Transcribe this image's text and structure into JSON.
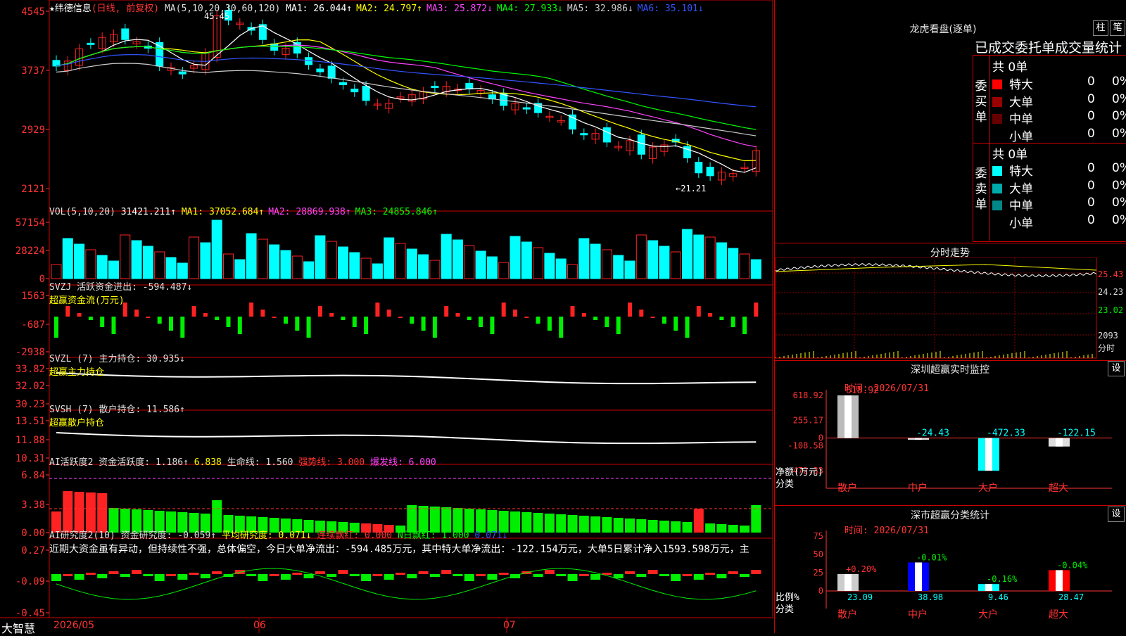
{
  "stock": {
    "name": "★纬德信息",
    "mode": "(日线, 前复权)",
    "ma_text": "MA(5,10,20,30,60,120)",
    "ma": [
      {
        "label": "MA1: 26.044↑",
        "color": "#ffffff"
      },
      {
        "label": "MA2: 24.797↑",
        "color": "#ffff00"
      },
      {
        "label": "MA3: 25.872↓",
        "color": "#ff44ff"
      },
      {
        "label": "MA4: 27.933↓",
        "color": "#00ff00"
      },
      {
        "label": "MA5: 32.986↓",
        "color": "#cccccc"
      },
      {
        "label": "MA6: 35.101↓",
        "color": "#3355ff"
      }
    ],
    "high_mark": "45.45",
    "low_mark": "21.21",
    "price_ticks": [
      "4545",
      "3737",
      "2929",
      "2121"
    ]
  },
  "vol": {
    "title": "VOL(5,10,20)",
    "value": "31421.211↑",
    "ma": [
      {
        "label": "MA1: 37052.684↑",
        "color": "#ffff00"
      },
      {
        "label": "MA2: 28869.938↑",
        "color": "#ff44ff"
      },
      {
        "label": "MA3: 24855.846↑",
        "color": "#00ff00"
      }
    ],
    "ticks": [
      "57154",
      "28224",
      "0"
    ]
  },
  "svzj": {
    "title": "SVZJ  活跃资金进出: -594.487↓",
    "sub": "超赢资金流(万元)",
    "ticks": [
      "1563",
      "-687",
      "-2938"
    ]
  },
  "svzl": {
    "title": "SVZL (7) 主力持仓: 30.935↓",
    "sub": "超赢主力持仓",
    "ticks": [
      "33.82",
      "32.02",
      "30.23"
    ]
  },
  "svsh": {
    "title": "SVSH (7) 散户持仓: 11.586↑",
    "sub": "超赢散户持仓",
    "ticks": [
      "13.51",
      "11.88",
      "10.31"
    ]
  },
  "ai2": {
    "title": "AI活跃度2 资金活跃度: 1.186↑",
    "v2": "6.838",
    "life": "生命线: 1.560",
    "strong": "强势线: 3.000",
    "burst": "爆发线: 6.000",
    "ticks": [
      "6.84",
      "3.38",
      "0.00"
    ]
  },
  "ai_res": {
    "title": "AI研究度2(10) 资金研究度: -0.059↑",
    "avg": "平均研究度: 0.071↓",
    "cont": "连续飘红: 0.000",
    "nday": "N日飘红: 1.000",
    "last": "0.071↓",
    "comment": "近期大资金虽有异动，但持续性不强，总体偏空，今日大单净流出：-594.485万元，其中特大单净流出：-122.154万元，大单5日累计净入1593.598万元，主",
    "ticks": [
      "0.27",
      "-0.09",
      "-0.45"
    ]
  },
  "xaxis": {
    "brand": "大智慧",
    "d1": "2026/05",
    "d2": "06",
    "d3": "07"
  },
  "right": {
    "dragon_title": "龙虎看盘(逐单)",
    "btn1": "柱",
    "btn2": "笔",
    "stat_title": "已成交委托单成交量统计",
    "buy": {
      "label": "委买单",
      "total": "共 0单",
      "rows": [
        {
          "name": "特大",
          "c": "#ff0000",
          "v": "0",
          "p": "0%"
        },
        {
          "name": "大单",
          "c": "#990000",
          "v": "0",
          "p": "0%"
        },
        {
          "name": "中单",
          "c": "#660000",
          "v": "0",
          "p": "0%"
        },
        {
          "name": "小单",
          "c": "#000000",
          "v": "0",
          "p": "0%"
        }
      ]
    },
    "sell": {
      "label": "委卖单",
      "total": "共 0单",
      "rows": [
        {
          "name": "特大",
          "c": "#00ffff",
          "v": "0",
          "p": "0%"
        },
        {
          "name": "大单",
          "c": "#00aaaa",
          "v": "0",
          "p": "0%"
        },
        {
          "name": "中单",
          "c": "#008888",
          "v": "0",
          "p": "0%"
        },
        {
          "name": "小单",
          "c": "#000000",
          "v": "0",
          "p": "0%"
        }
      ]
    },
    "intraday_title": "分时走势",
    "intraday_ticks": [
      "25.43",
      "24.23",
      "23.02"
    ],
    "intraday_vol": "2093",
    "intraday_unit": "分时",
    "sz_title": "深圳超赢实时监控",
    "sz_btn": "设",
    "sz_time": "时间: 2026/07/31",
    "sz_ticks": [
      "618.92",
      "255.17",
      "0",
      "-108.58",
      "-472.33"
    ],
    "sz_ylabel": "净额(万元)",
    "sz_xlabel": "分类",
    "sz_bars": [
      {
        "cat": "散户",
        "value": 618.92,
        "label": "618.92"
      },
      {
        "cat": "中户",
        "value": -24.43,
        "label": "-24.43"
      },
      {
        "cat": "大户",
        "value": -472.33,
        "label": "-472.33"
      },
      {
        "cat": "超大",
        "value": -122.15,
        "label": "-122.15"
      }
    ],
    "sc_title": "深市超赢分类统计",
    "sc_btn": "设",
    "sc_time": "时间: 2026/07/31",
    "sc_ticks": [
      "75",
      "50",
      "25",
      "0"
    ],
    "sc_ylabel": "比例%",
    "sc_xlabel": "分类",
    "sc_bars": [
      {
        "cat": "散户",
        "value": 23.09,
        "label": "23.09",
        "chg": "+0.20%"
      },
      {
        "cat": "中户",
        "value": 38.98,
        "label": "38.98",
        "chg": "-0.01%"
      },
      {
        "cat": "大户",
        "value": 9.46,
        "label": "9.46",
        "chg": "-0.16%"
      },
      {
        "cat": "超大",
        "value": 28.47,
        "label": "28.47",
        "chg": "-0.04%"
      }
    ]
  },
  "chart_data": [
    {
      "type": "bar",
      "title": "深圳超赢实时监控",
      "ylabel": "净额(万元)",
      "xlabel": "分类",
      "categories": [
        "散户",
        "中户",
        "大户",
        "超大"
      ],
      "values": [
        618.92,
        -24.43,
        -472.33,
        -122.15
      ],
      "ylim": [
        -472.33,
        618.92
      ]
    },
    {
      "type": "bar",
      "title": "深市超赢分类统计",
      "ylabel": "比例%",
      "xlabel": "分类",
      "categories": [
        "散户",
        "中户",
        "大户",
        "超大"
      ],
      "values": [
        23.09,
        38.98,
        9.46,
        28.47
      ],
      "ylim": [
        0,
        75
      ]
    },
    {
      "type": "line",
      "title": "纬德信息 日K线",
      "ylim": [
        21.21,
        45.45
      ]
    }
  ]
}
